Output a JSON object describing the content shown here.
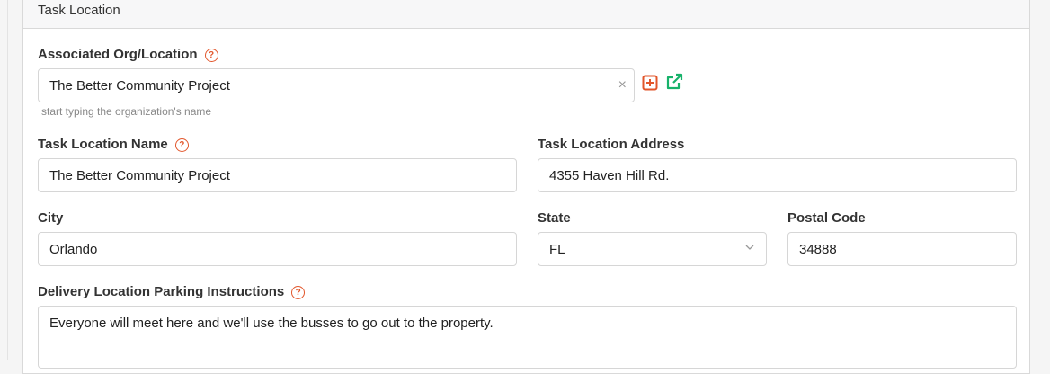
{
  "section": {
    "title": "Task Location"
  },
  "org": {
    "label": "Associated Org/Location",
    "value": "The Better Community Project",
    "clear_symbol": "×",
    "hint": "start typing the organization's name"
  },
  "task_location_name": {
    "label": "Task Location Name",
    "value": "The Better Community Project"
  },
  "task_location_address": {
    "label": "Task Location Address",
    "value": "4355 Haven Hill Rd."
  },
  "city": {
    "label": "City",
    "value": "Orlando"
  },
  "state": {
    "label": "State",
    "value": "FL"
  },
  "postal_code": {
    "label": "Postal Code",
    "value": "34888"
  },
  "parking": {
    "label": "Delivery Location Parking Instructions",
    "value": "Everyone will meet here and we'll use the busses to go out to the property."
  },
  "icons": {
    "help": "?",
    "help_color": "#e2562b",
    "add_color": "#e2562b",
    "external_color": "#17b26a"
  }
}
